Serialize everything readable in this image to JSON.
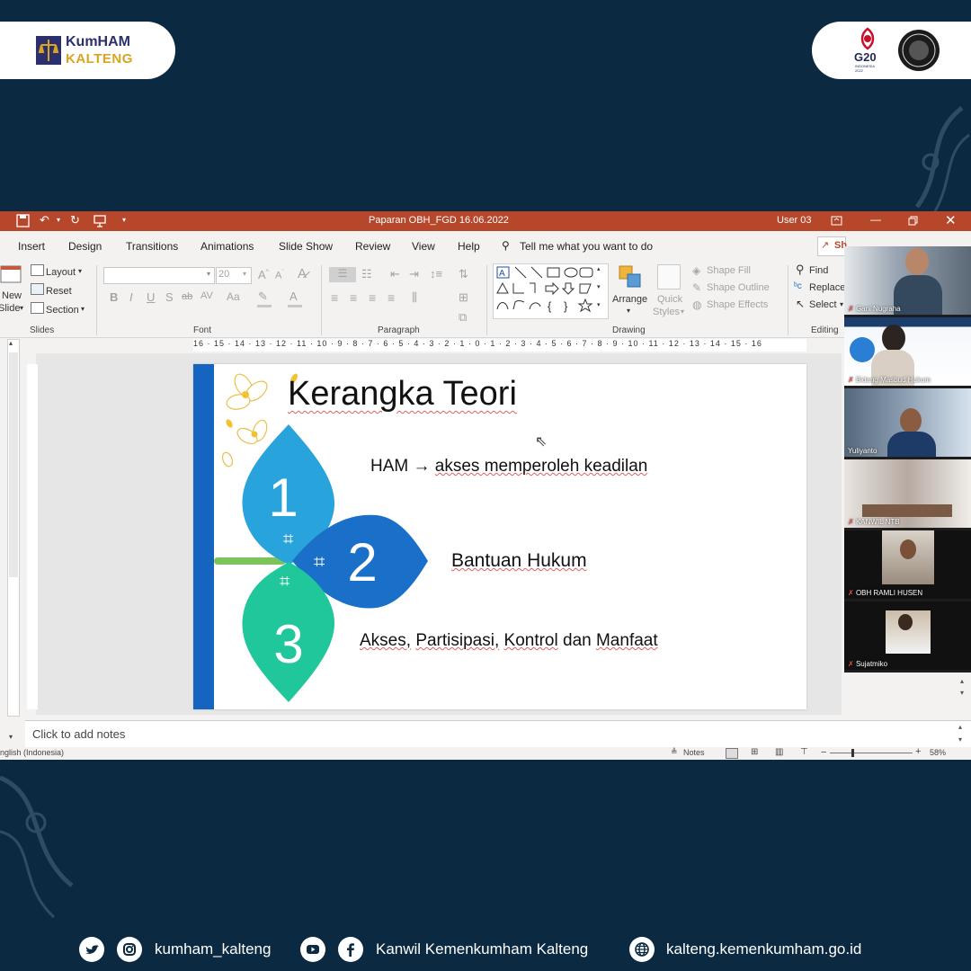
{
  "header": {
    "logo_top": "KumHAM",
    "logo_bottom": "KALTENG",
    "g20": "G20",
    "g20_sub": "INDONESIA 2022"
  },
  "app": {
    "title": "Paparan OBH_FGD 16.06.2022",
    "user": "User 03",
    "accent": "#b7472a",
    "tabs": [
      "Insert",
      "Design",
      "Transitions",
      "Animations",
      "Slide Show",
      "Review",
      "View",
      "Help"
    ],
    "tell_me": "Tell me what you want to do",
    "share_partial": "Sh"
  },
  "ribbon": {
    "slides": {
      "new_slide_1": "New",
      "new_slide_2": "Slide",
      "layout": "Layout",
      "reset": "Reset",
      "section": "Section",
      "label": "Slides"
    },
    "font": {
      "size": "20",
      "label": "Font"
    },
    "paragraph": {
      "label": "Paragraph"
    },
    "drawing": {
      "arrange": "Arrange",
      "quick_styles_1": "Quick",
      "quick_styles_2": "Styles",
      "shape_fill": "Shape Fill",
      "shape_outline": "Shape Outline",
      "shape_effects": "Shape Effects",
      "label": "Drawing"
    },
    "editing": {
      "find": "Find",
      "replace": "Replace",
      "select": "Select",
      "label": "Editing"
    }
  },
  "ruler": {
    "text": "16 · 15 · 14 · 13 · 12 · 11 · 10 · 9 · 8 · 7 · 6 · 5 · 4 · 3 · 2 · 1 · 0 · 1 · 2 · 3 · 4 · 5 · 6 · 7 · 8 · 9 · 10 · 11 · 12 · 13 · 14 · 15 · 16"
  },
  "slide": {
    "title": "Kerangka Teori",
    "items": [
      {
        "number": "1",
        "text_a": "HAM",
        "arrow": "→",
        "text_b": "akses memperoleh keadilan"
      },
      {
        "number": "2",
        "text": "Bantuan Hukum"
      },
      {
        "number": "3",
        "text_a": "Akses,",
        "text_b": "Partisipasi,",
        "text_c": "Kontrol",
        "text_d": "dan",
        "text_e": "Manfaat"
      }
    ],
    "colors": {
      "bar": "#1565c0",
      "petal1": "#29a3dc",
      "petal2": "#1a6fc9",
      "petal3": "#1fc79a",
      "stem": "#7cc35a"
    }
  },
  "notes": {
    "placeholder": "Click to add notes"
  },
  "status": {
    "language": "nglish (Indonesia)",
    "notes_btn": "Notes",
    "zoom": "58%"
  },
  "participants": [
    {
      "name": "Gani Nugraha"
    },
    {
      "name": "Bidang Masbud Hukum"
    },
    {
      "name": "Yuliyanto"
    },
    {
      "name": "KANWIL NTB"
    },
    {
      "name": "OBH RAMLI HUSEN"
    },
    {
      "name": "Sujatmiko"
    }
  ],
  "footer": {
    "instagram": "kumham_kalteng",
    "facebook": "Kanwil Kemenkumham Kalteng",
    "website": "kalteng.kemenkumham.go.id"
  }
}
